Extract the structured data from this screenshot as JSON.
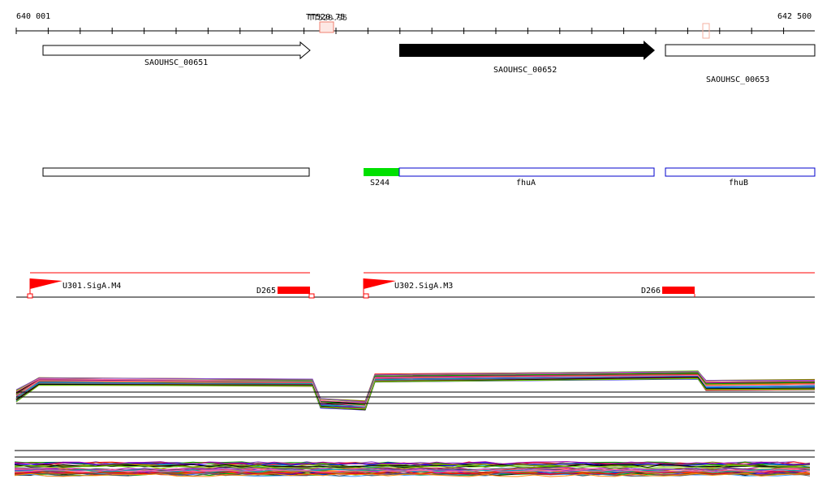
{
  "ruler": {
    "start_label": "640 001",
    "end_label": "642 500",
    "terminators": [
      "TT520.75",
      "TT520.95"
    ]
  },
  "genes": [
    {
      "name": "SAOUHSC_00651",
      "strand": "+",
      "filled": false
    },
    {
      "name": "SAOUHSC_00652",
      "strand": "+",
      "filled": true
    },
    {
      "name": "SAOUHSC_00653",
      "strand": "+",
      "filled": false
    }
  ],
  "features": [
    {
      "name": "S244",
      "color": "#00e000"
    },
    {
      "name": "fhuA",
      "color": "#0000cc"
    },
    {
      "name": "fhuB",
      "color": "#0000cc"
    }
  ],
  "promoters": [
    {
      "name": "U301.SigA.M4",
      "down": "D265"
    },
    {
      "name": "U302.SigA.M3",
      "down": "D266"
    }
  ],
  "colors": {
    "accent": "#ff0000"
  }
}
